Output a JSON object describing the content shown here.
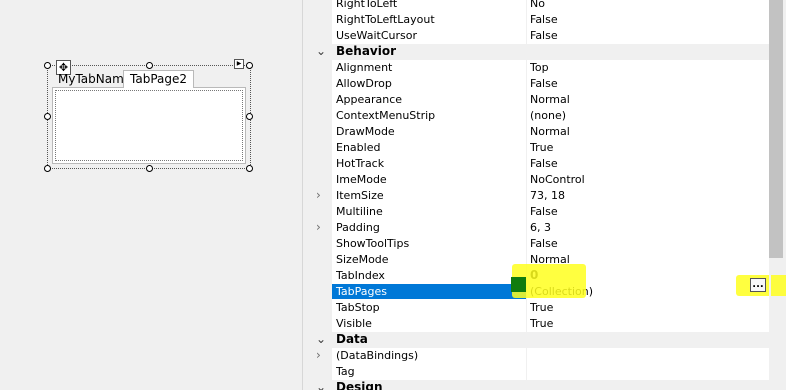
{
  "designer": {
    "move_glyph": "✥",
    "smart_tag": "▶",
    "tabs": [
      {
        "label": "MyTabName"
      },
      {
        "label": "TabPage2"
      }
    ]
  },
  "property_grid": {
    "rows": [
      {
        "kind": "prop",
        "name": "RightToLeft",
        "value": "No"
      },
      {
        "kind": "prop",
        "name": "RightToLeftLayout",
        "value": "False"
      },
      {
        "kind": "prop",
        "name": "UseWaitCursor",
        "value": "False"
      },
      {
        "kind": "cat",
        "name": "Behavior",
        "expander": "⌄"
      },
      {
        "kind": "prop",
        "name": "Alignment",
        "value": "Top"
      },
      {
        "kind": "prop",
        "name": "AllowDrop",
        "value": "False"
      },
      {
        "kind": "prop",
        "name": "Appearance",
        "value": "Normal"
      },
      {
        "kind": "prop",
        "name": "ContextMenuStrip",
        "value": "(none)"
      },
      {
        "kind": "prop",
        "name": "DrawMode",
        "value": "Normal"
      },
      {
        "kind": "prop",
        "name": "Enabled",
        "value": "True"
      },
      {
        "kind": "prop",
        "name": "HotTrack",
        "value": "False"
      },
      {
        "kind": "prop",
        "name": "ImeMode",
        "value": "NoControl"
      },
      {
        "kind": "prop",
        "name": "ItemSize",
        "value": "73, 18",
        "expander": "›"
      },
      {
        "kind": "prop",
        "name": "Multiline",
        "value": "False"
      },
      {
        "kind": "prop",
        "name": "Padding",
        "value": "6, 3",
        "expander": "›"
      },
      {
        "kind": "prop",
        "name": "ShowToolTips",
        "value": "False"
      },
      {
        "kind": "prop",
        "name": "SizeMode",
        "value": "Normal"
      },
      {
        "kind": "prop",
        "name": "TabIndex",
        "value": "0",
        "bold": true
      },
      {
        "kind": "prop",
        "name": "TabPages",
        "value": "(Collection)",
        "selected": true
      },
      {
        "kind": "prop",
        "name": "TabStop",
        "value": "True"
      },
      {
        "kind": "prop",
        "name": "Visible",
        "value": "True"
      },
      {
        "kind": "cat",
        "name": "Data",
        "expander": "⌄"
      },
      {
        "kind": "prop",
        "name": "(DataBindings)",
        "value": "",
        "expander": "›"
      },
      {
        "kind": "prop",
        "name": "Tag",
        "value": ""
      },
      {
        "kind": "cat",
        "name": "Design",
        "expander": "⌄"
      }
    ],
    "ellipsis_label": "...",
    "highlight_color": "#ffff1f",
    "selection_color": "#0078d7"
  }
}
